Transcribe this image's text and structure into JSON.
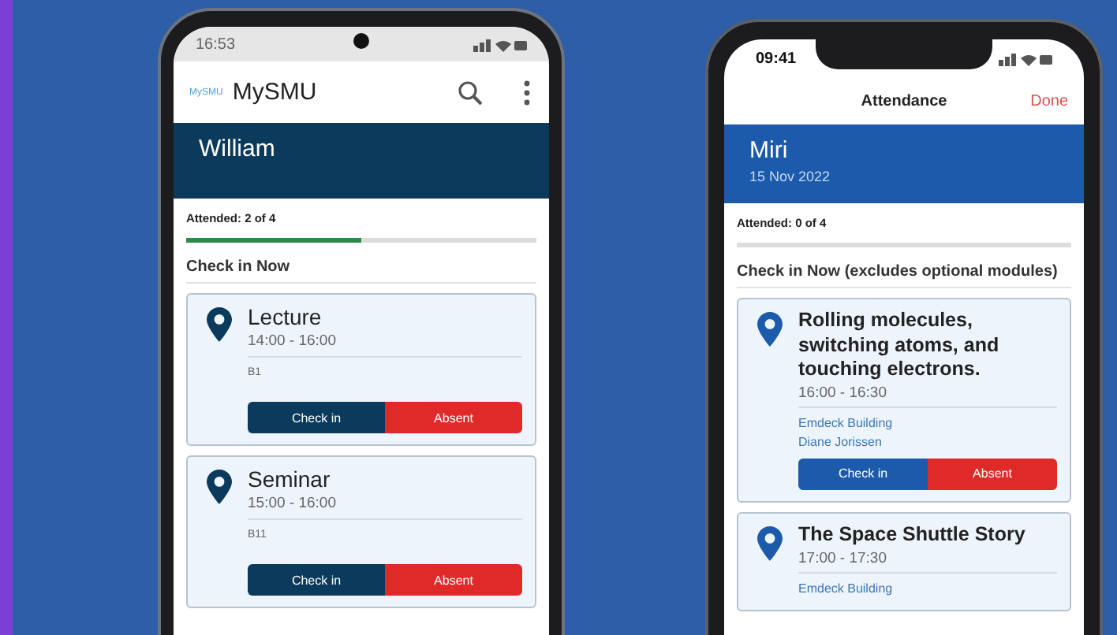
{
  "phones": [
    {
      "kind": "android",
      "status_time": "16:53",
      "logo": "MySMU",
      "app_title": "MySMU",
      "header": {
        "name": "William"
      },
      "attended": "Attended: 2 of 4",
      "progress": {
        "level": 0.5
      },
      "section_title": "Check in Now",
      "sessions": [
        {
          "title": "Lecture",
          "time": "14:00 - 16:00",
          "details": [
            "B1"
          ],
          "buttons": [
            "Check in",
            "Absent"
          ]
        },
        {
          "title": "Seminar",
          "time": "15:00 - 16:00",
          "details": [
            "B11"
          ],
          "buttons": [
            "Check in",
            "Absent"
          ]
        }
      ]
    },
    {
      "kind": "ios",
      "status_time": "09:41",
      "nav_title": "Attendance",
      "nav_action": "Done",
      "header": {
        "name": "Miri",
        "date": "15 Nov 2022"
      },
      "attended": "Attended: 0 of 4",
      "section_title": "Check in Now (excludes optional modules)",
      "sessions": [
        {
          "title": "Rolling molecules, switching atoms, and touching electrons.",
          "time": "16:00 - 16:30",
          "details": [
            "Emdeck Building",
            "Diane Jorissen"
          ],
          "buttons": [
            "Check in",
            "Absent"
          ]
        },
        {
          "title": "The Space Shuttle Story",
          "time": "17:00 - 17:30",
          "details": [
            "Emdeck Building"
          ]
        }
      ]
    }
  ]
}
